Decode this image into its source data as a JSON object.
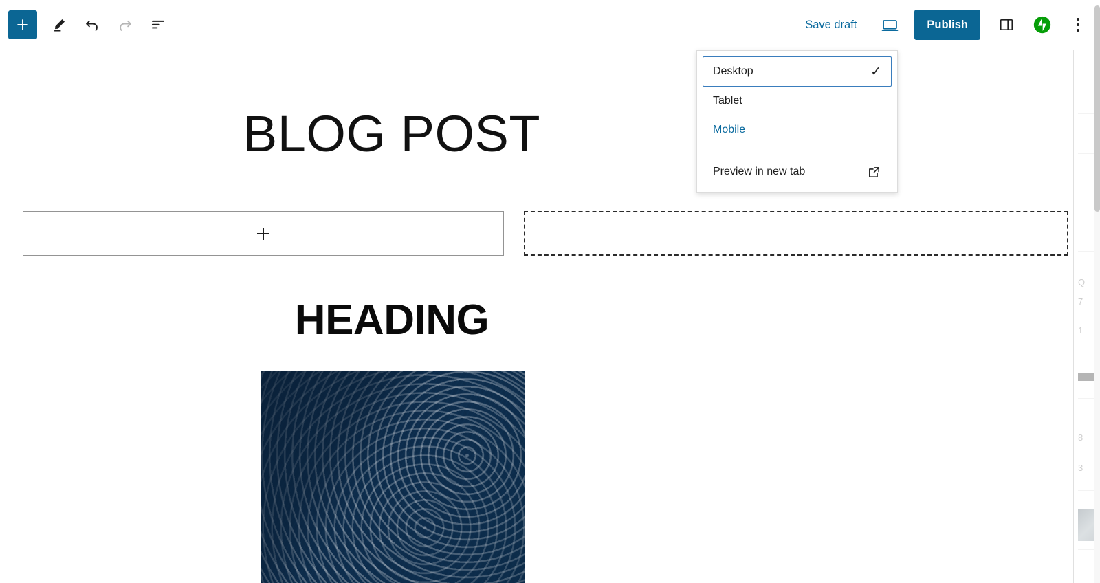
{
  "toolbar": {
    "add_block_label": "+",
    "add_block_icon": "plus-icon",
    "tools_icon": "pencil-edit-icon",
    "undo_icon": "undo-arrow-icon",
    "redo_icon": "redo-arrow-icon",
    "details_icon": "document-outline-icon",
    "save_draft_label": "Save draft",
    "preview_icon": "desktop-preview-icon",
    "publish_label": "Publish",
    "settings_icon": "sidebar-panel-icon",
    "jetpack_icon": "jetpack-logo-icon",
    "more_icon": "more-vertical-dots-icon"
  },
  "preview_menu": {
    "items": [
      {
        "label": "Desktop",
        "selected": true,
        "checkmark": "✓"
      },
      {
        "label": "Tablet",
        "selected": false
      },
      {
        "label": "Mobile",
        "selected": false,
        "highlight": true
      }
    ],
    "footer": {
      "label": "Preview in new tab",
      "icon": "external-link-icon"
    }
  },
  "editor": {
    "post_title": "BLOG POST",
    "columns": {
      "left_placeholder_icon": "plus-icon",
      "left_placeholder_name": "empty-column-appender",
      "right_placeholder_name": "empty-column-dashed"
    },
    "section_heading": "HEADING",
    "image_alt": "ocean-wave-photo"
  },
  "colors": {
    "accent_blue": "#0b6694",
    "link_blue": "#0a6a9e",
    "jetpack_green": "#069e08",
    "border_gray": "#e0e0e0",
    "placeholder_border": "#949494",
    "dashed_border": "#2b2b2b",
    "text_dark": "#1e1e1e"
  },
  "sliver": {
    "lines": [
      "Q",
      "7",
      "1",
      "8",
      "3"
    ]
  }
}
